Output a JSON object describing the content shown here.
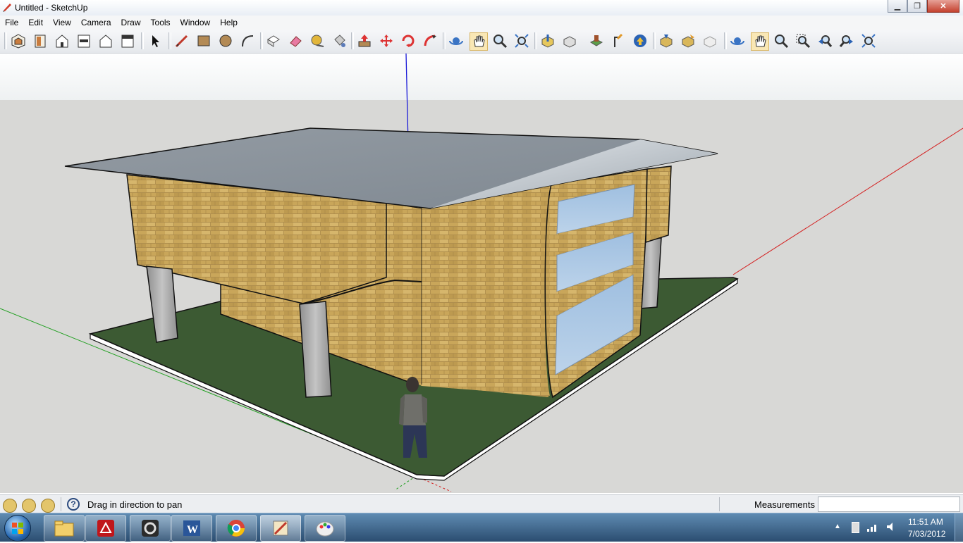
{
  "window": {
    "title": "Untitled - SketchUp"
  },
  "menu": {
    "items": [
      "File",
      "Edit",
      "View",
      "Camera",
      "Draw",
      "Tools",
      "Window",
      "Help"
    ]
  },
  "toolbar": {
    "icons": [
      "iso-view-icon",
      "top-view-icon",
      "front-view-icon",
      "right-view-icon",
      "back-view-icon",
      "left-view-icon",
      "select-icon",
      "line-icon",
      "rectangle-icon",
      "circle-icon",
      "arc-icon",
      "make-component-icon",
      "eraser-icon",
      "tape-measure-icon",
      "paint-bucket-icon",
      "push-pull-icon",
      "move-icon",
      "rotate-icon",
      "follow-me-icon",
      "orbit-icon",
      "pan-icon",
      "zoom-icon",
      "zoom-extents-icon",
      "get-models-icon",
      "share-model-icon",
      "place-model-icon",
      "preview-earth-icon",
      "add-location-icon",
      "get-photo-icon",
      "photo-textures-icon",
      "toggle-terrain-icon",
      "orbit-2-icon",
      "pan-2-icon",
      "zoom-2-icon",
      "zoom-window-icon",
      "previous-view-icon",
      "next-view-icon",
      "zoom-extents-2-icon"
    ]
  },
  "status": {
    "hint": "Drag in direction to pan",
    "measurements_label": "Measurements",
    "measurements_value": ""
  },
  "taskbar": {
    "apps": [
      "explorer-icon",
      "acrobat-icon",
      "sketchup-layout-icon",
      "word-icon",
      "chrome-icon",
      "sketchup-icon",
      "paint-icon"
    ],
    "time": "11:51 AM",
    "date": "7/03/2012"
  },
  "colors": {
    "sky": "#f4f6f7",
    "ground": "#d8d8d6",
    "grass": "#3c5a33",
    "brick": "#c9a65a",
    "roof": "#8e97a0",
    "glass": "#a9c6e2",
    "column": "#a7a7a7"
  }
}
